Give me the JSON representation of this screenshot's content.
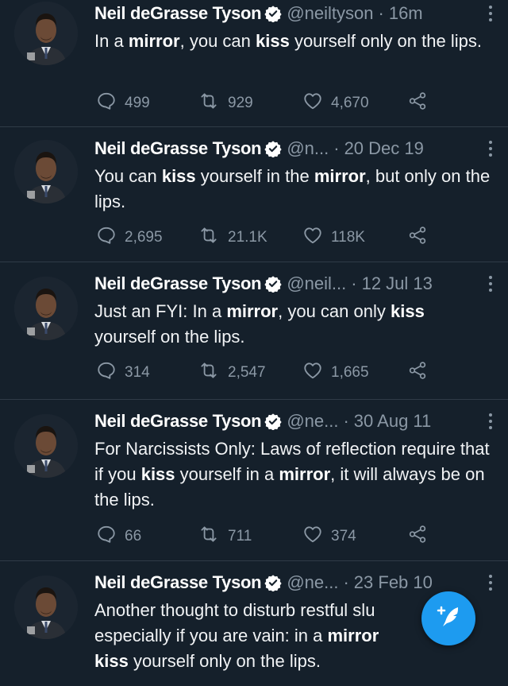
{
  "author": {
    "name": "Neil deGrasse Tyson"
  },
  "colors": {
    "background": "#15202b",
    "secondary_text": "#8b98a5",
    "divider": "#2f3b47",
    "accent": "#1d9bf0"
  },
  "icons": {
    "verified": "verified-badge-icon",
    "more": "more-vertical-icon",
    "reply": "reply-icon",
    "retweet": "retweet-icon",
    "like": "heart-icon",
    "share": "share-icon",
    "compose": "compose-tweet-icon"
  },
  "tweets": [
    {
      "handle": "@neiltyson",
      "time": "16m",
      "segments": [
        {
          "t": "In a ",
          "b": false
        },
        {
          "t": "mirror",
          "b": true
        },
        {
          "t": ", you can ",
          "b": false
        },
        {
          "t": "kiss",
          "b": true
        },
        {
          "t": " yourself only on the lips.",
          "b": false
        }
      ],
      "replies": "499",
      "retweets": "929",
      "likes": "4,670"
    },
    {
      "handle": "@n...",
      "time": "20 Dec 19",
      "segments": [
        {
          "t": "You can ",
          "b": false
        },
        {
          "t": "kiss",
          "b": true
        },
        {
          "t": " yourself in the ",
          "b": false
        },
        {
          "t": "mirror",
          "b": true
        },
        {
          "t": ", but only on the lips.",
          "b": false
        }
      ],
      "replies": "2,695",
      "retweets": "21.1K",
      "likes": "118K"
    },
    {
      "handle": "@neil...",
      "time": "12 Jul 13",
      "segments": [
        {
          "t": "Just an FYI:  In a ",
          "b": false
        },
        {
          "t": "mirror",
          "b": true
        },
        {
          "t": ", you can only ",
          "b": false
        },
        {
          "t": "kiss",
          "b": true
        },
        {
          "t": " yourself on the lips.",
          "b": false
        }
      ],
      "replies": "314",
      "retweets": "2,547",
      "likes": "1,665"
    },
    {
      "handle": "@ne...",
      "time": "30 Aug 11",
      "segments": [
        {
          "t": "For Narcissists Only: Laws of reflection require that if you ",
          "b": false
        },
        {
          "t": "kiss",
          "b": true
        },
        {
          "t": " yourself in a ",
          "b": false
        },
        {
          "t": "mirror",
          "b": true
        },
        {
          "t": ", it will always be on the lips.",
          "b": false
        }
      ],
      "replies": "66",
      "retweets": "711",
      "likes": "374"
    },
    {
      "handle": "@ne...",
      "time": "23 Feb 10",
      "segments": [
        {
          "t": "Another thought to disturb restful slu",
          "b": false
        },
        {
          "t": "\n",
          "b": false
        },
        {
          "t": "especially if you are vain: in a ",
          "b": false
        },
        {
          "t": "mirror",
          "b": true
        },
        {
          "t": "\n",
          "b": false
        },
        {
          "t": "kiss",
          "b": true
        },
        {
          "t": " yourself only on the lips.",
          "b": false
        }
      ]
    }
  ]
}
